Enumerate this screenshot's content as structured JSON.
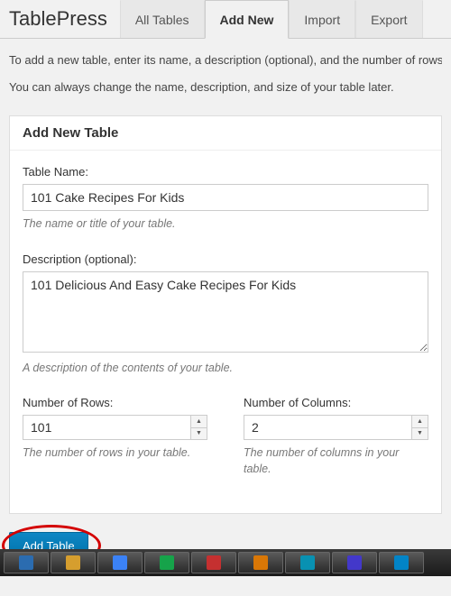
{
  "header": {
    "plugin_name": "TablePress",
    "tabs": [
      {
        "label": "All Tables",
        "active": false
      },
      {
        "label": "Add New",
        "active": true
      },
      {
        "label": "Import",
        "active": false
      },
      {
        "label": "Export",
        "active": false
      }
    ]
  },
  "intro": {
    "line1": "To add a new table, enter its name, a description (optional), and the number of rows",
    "line2": "You can always change the name, description, and size of your table later."
  },
  "panel": {
    "title": "Add New Table",
    "name": {
      "label": "Table Name:",
      "value": "101 Cake Recipes For Kids",
      "hint": "The name or title of your table."
    },
    "description": {
      "label": "Description (optional):",
      "value": "101 Delicious And Easy Cake Recipes For Kids",
      "hint": "A description of the contents of your table."
    },
    "rows": {
      "label": "Number of Rows:",
      "value": "101",
      "hint": "The number of rows in your table."
    },
    "cols": {
      "label": "Number of Columns:",
      "value": "2",
      "hint": "The number of columns in your table."
    }
  },
  "submit": {
    "button_label": "Add Table"
  },
  "taskbar_colors": [
    "#2b6cb0",
    "#d69e2e",
    "#3b82f6",
    "#16a34a",
    "#c53030",
    "#d97706",
    "#0891b2",
    "#4338ca",
    "#0284c7"
  ]
}
